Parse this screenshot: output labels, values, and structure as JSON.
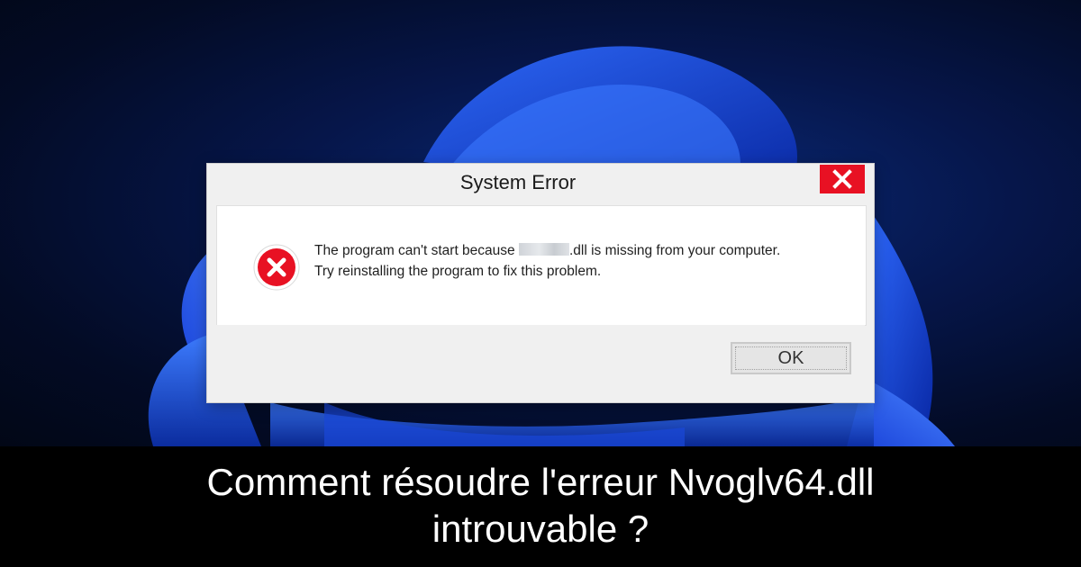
{
  "dialog": {
    "title": "System Error",
    "message_line1_before": "The program can't start because ",
    "message_line1_after": ".dll is missing from your computer.",
    "message_line2": "Try reinstalling the program to fix this problem.",
    "ok_label": "OK",
    "icon": "error-icon",
    "close_icon": "close-icon"
  },
  "caption": {
    "line1": "Comment résoudre l'erreur Nvoglv64.dll",
    "line2": "introuvable ?"
  },
  "colors": {
    "close_button": "#e81123",
    "error_icon": "#e81123",
    "wallpaper_accent": "#1f5bff",
    "caption_background": "#000000"
  }
}
